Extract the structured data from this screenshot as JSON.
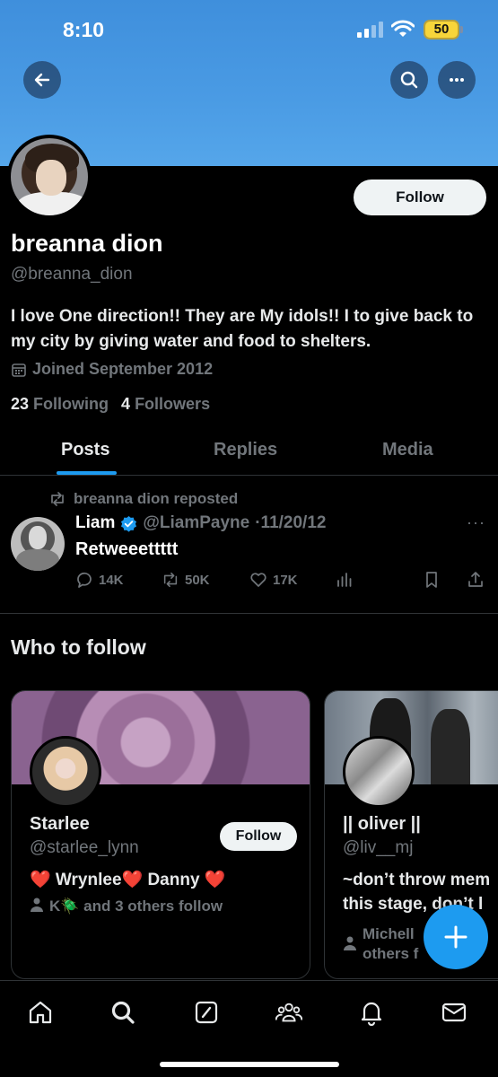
{
  "status_bar": {
    "time": "8:10",
    "battery": "50"
  },
  "profile": {
    "name": "breanna dion",
    "handle": "@breanna_dion",
    "bio": "I love One direction!! They are My idols!! I to give back to my city by giving water and food to shelters.",
    "joined": "Joined September 2012",
    "following_count": "23",
    "following_label": "Following",
    "followers_count": "4",
    "followers_label": "Followers",
    "follow_button": "Follow"
  },
  "tabs": [
    {
      "label": "Posts",
      "active": true
    },
    {
      "label": "Replies",
      "active": false
    },
    {
      "label": "Media",
      "active": false
    }
  ],
  "tweet": {
    "repost_label": "breanna dion reposted",
    "author": "Liam",
    "handle": "@LiamPayne",
    "date": "·11/20/12",
    "text": "Retweeettttt",
    "replies": "14K",
    "reposts": "50K",
    "likes": "17K"
  },
  "who_to_follow": {
    "title": "Who to follow",
    "cards": [
      {
        "name": "Starlee",
        "handle": "@starlee_lynn",
        "bio": "❤️ Wrynlee❤️ Danny ❤️",
        "followed_by": "K🪲 and 3 others follow",
        "follow_label": "Follow"
      },
      {
        "name": "|| oliver ||",
        "handle": "@liv__mj",
        "bio_line1": "~don’t throw mem",
        "bio_line2": "this stage, don’t l",
        "followed_by_line1": "Michell",
        "followed_by_line2": "others f"
      }
    ]
  },
  "colors": {
    "accent": "#1d9bf0",
    "banner": "#4a9be4",
    "muted": "#71767b"
  },
  "icons": {
    "nav": [
      "home-icon",
      "search-icon",
      "compose-icon",
      "communities-icon",
      "notifications-icon",
      "messages-icon"
    ]
  }
}
